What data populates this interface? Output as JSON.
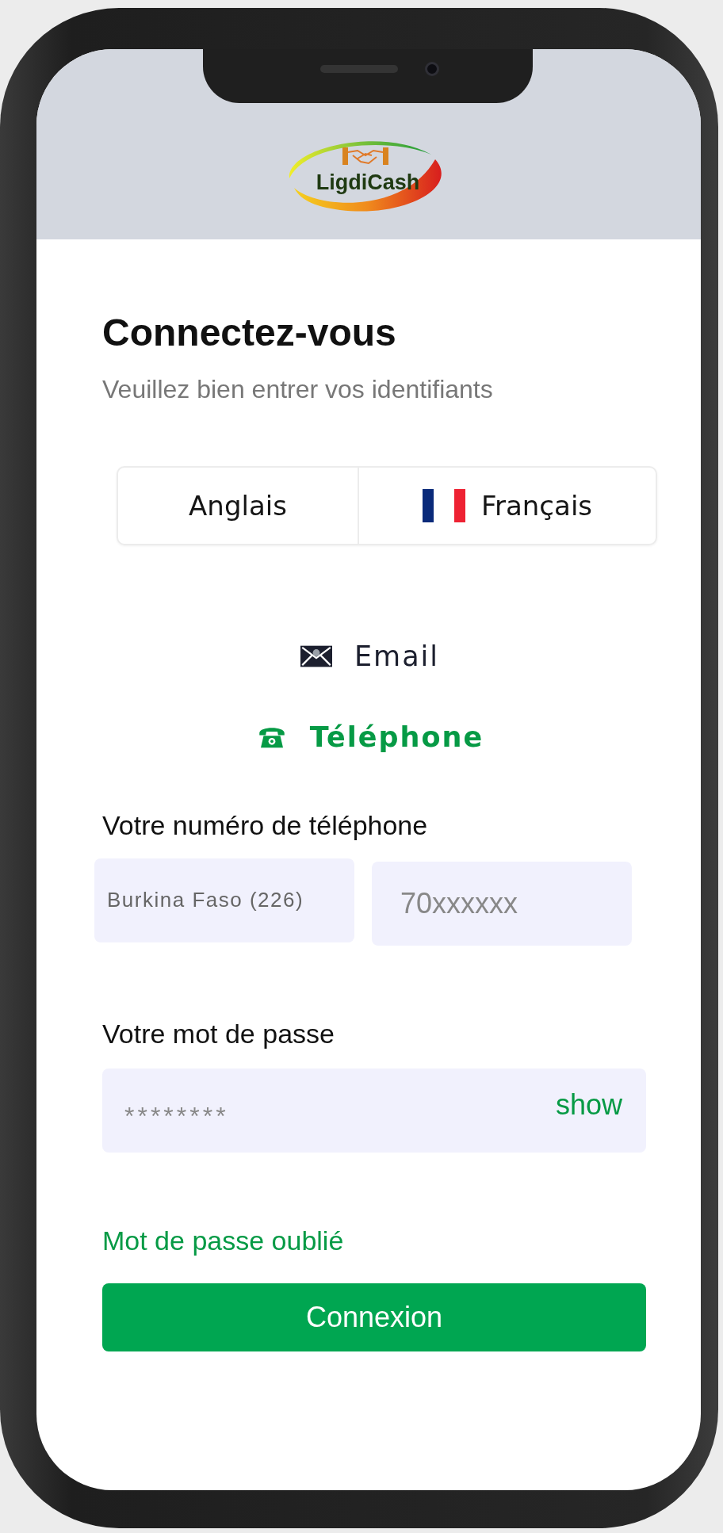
{
  "header": {
    "logo_text": "LigdiCash"
  },
  "title": "Connectez-vous",
  "subtitle": "Veuillez bien entrer vos identifiants",
  "languages": [
    {
      "label": "Anglais",
      "kind": "plain"
    },
    {
      "label": "Français",
      "kind": "flag"
    }
  ],
  "methods": [
    {
      "label": "Email",
      "kind": "email",
      "selected": false
    },
    {
      "label": "Téléphone",
      "kind": "phone",
      "selected": true
    }
  ],
  "phone": {
    "label": "Votre numéro de téléphone",
    "country": "Burkina Faso (226)",
    "placeholder": "70xxxxxx"
  },
  "password": {
    "label": "Votre mot de passe",
    "placeholder": "********",
    "toggle": "show"
  },
  "forgot": "Mot de passe oublié",
  "submit": "Connexion"
}
